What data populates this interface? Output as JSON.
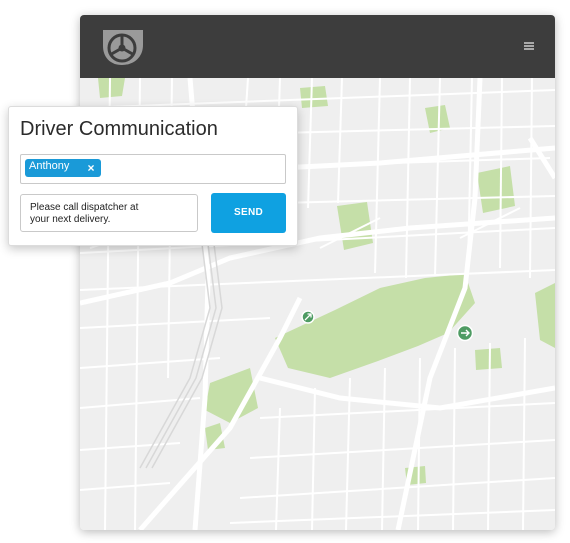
{
  "colors": {
    "topbar": "#3d3d3d",
    "map_background": "#efefef",
    "map_roads": "#ffffff",
    "map_parks": "#c5dfa8",
    "marker": "#4e9b63",
    "accent": "#0fa1e1"
  },
  "header": {
    "logo_icon": "steering-wheel-shield-logo",
    "menu_icon": "hamburger-menu-icon"
  },
  "map": {
    "markers": [
      {
        "icon": "arrow-right-icon"
      },
      {
        "icon": "arrows-expand-icon"
      }
    ]
  },
  "panel": {
    "title": "Driver Communication",
    "recipients": [
      {
        "name": "Anthony",
        "remove_icon": "close-icon",
        "remove_glyph": "×"
      }
    ],
    "message_line1": "Please call dispatcher at",
    "message_line2": "your next delivery.",
    "send_label": "SEND"
  }
}
